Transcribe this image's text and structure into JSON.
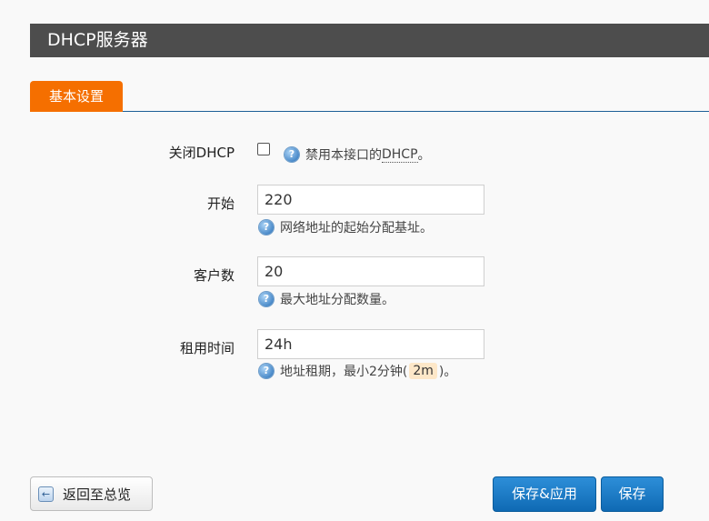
{
  "section": {
    "title": "DHCP服务器"
  },
  "tabs": [
    {
      "label": "基本设置",
      "active": true
    }
  ],
  "form": {
    "disable_dhcp": {
      "label": "关闭DHCP",
      "checked": false,
      "help_prefix": "禁用本接口的",
      "help_abbr": "DHCP",
      "help_suffix": "。"
    },
    "start": {
      "label": "开始",
      "value": "220",
      "help": "网络地址的起始分配基址。"
    },
    "limit": {
      "label": "客户数",
      "value": "20",
      "help": "最大地址分配数量。"
    },
    "leasetime": {
      "label": "租用时间",
      "value": "24h",
      "help_prefix": "地址租期，最小2分钟(",
      "help_code": "2m",
      "help_suffix": ")。"
    }
  },
  "icons": {
    "help": "help-icon",
    "back": "back-arrow-icon"
  },
  "buttons": {
    "back": "返回至总览",
    "save_apply": "保存&应用",
    "save": "保存"
  },
  "colors": {
    "header_bg": "#4d4d4d",
    "tab_active": "#f56f00",
    "primary_button": "#1a7cc7"
  }
}
